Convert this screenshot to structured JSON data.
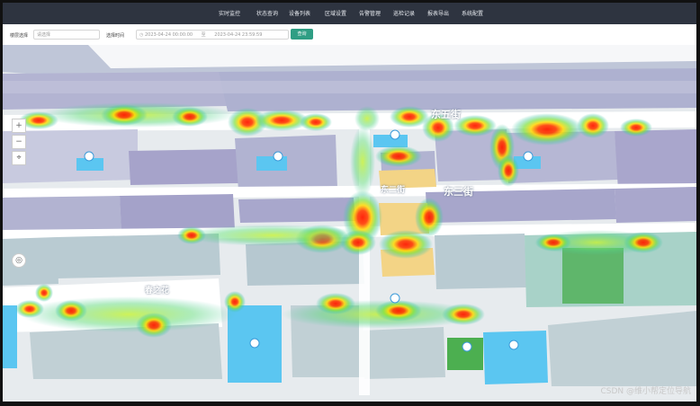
{
  "nav": {
    "items": [
      "实时监控",
      "状态查询",
      "设备列表",
      "区域设置",
      "告警管理",
      "巡检记录",
      "报表导出",
      "系统配置"
    ]
  },
  "filters": {
    "floor_label": "楼层选择",
    "floor_value": "请选择",
    "time_label": "选择时间",
    "start_time": "2023-04-24 00:00:00",
    "separator": "至",
    "end_time": "2023-04-24 23:59:59",
    "query_label": "查询"
  },
  "map": {
    "street_labels": [
      "东五街",
      "东三街",
      "东二街",
      "春之花"
    ],
    "icons": [
      "zoom-in-icon",
      "zoom-out-icon",
      "compass-icon",
      "locate-icon"
    ]
  },
  "watermark": "CSDN @维小帮定位导航",
  "colors": {
    "nav_bg": "#2e3440",
    "primary_button": "#2f9e84",
    "building_purple": "#a9a6cc",
    "building_grey": "#b9c8d0",
    "building_teal": "#a8d2c8",
    "road": "#ffffff",
    "water_blue": "#5bc6f1",
    "green_block": "#5fb66b",
    "yellow_block": "#f3d486"
  }
}
